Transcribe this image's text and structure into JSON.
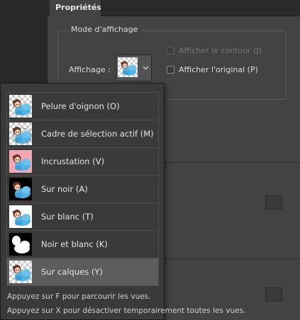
{
  "panel": {
    "tab_label": "Propriétés",
    "section_title": "Mode d'affichage",
    "display_label": "Affichage :",
    "show_edge_label": "Afficher le contour (J)",
    "show_original_label": "Afficher l'original (P)",
    "show_edge_checked": false,
    "show_edge_enabled": false,
    "show_original_checked": false
  },
  "menu": {
    "items": [
      {
        "label": "Pelure d'oignon (O)",
        "icon": "onion-skin-thumb",
        "selected": false
      },
      {
        "label": "Cadre de sélection actif (M)",
        "icon": "marching-ants-thumb",
        "selected": false
      },
      {
        "label": "Incrustation (V)",
        "icon": "overlay-thumb",
        "selected": false
      },
      {
        "label": "Sur noir (A)",
        "icon": "on-black-thumb",
        "selected": false
      },
      {
        "label": "Sur blanc (T)",
        "icon": "on-white-thumb",
        "selected": false
      },
      {
        "label": "Noir et blanc (K)",
        "icon": "black-white-thumb",
        "selected": false
      },
      {
        "label": "Sur calques (Y)",
        "icon": "on-layers-thumb",
        "selected": true
      }
    ],
    "hint_1": "Appuyez sur F pour parcourir les vues.",
    "hint_2": "Appuyez sur X pour désactiver temporairement toutes les vues."
  },
  "colors": {
    "panel_bg": "#434343",
    "menu_bg": "#3a3a3a",
    "selected_bg": "#5c5c5c",
    "overlay_pink": "#f2a7b1",
    "sheep_blue": "#4fb3e6"
  }
}
